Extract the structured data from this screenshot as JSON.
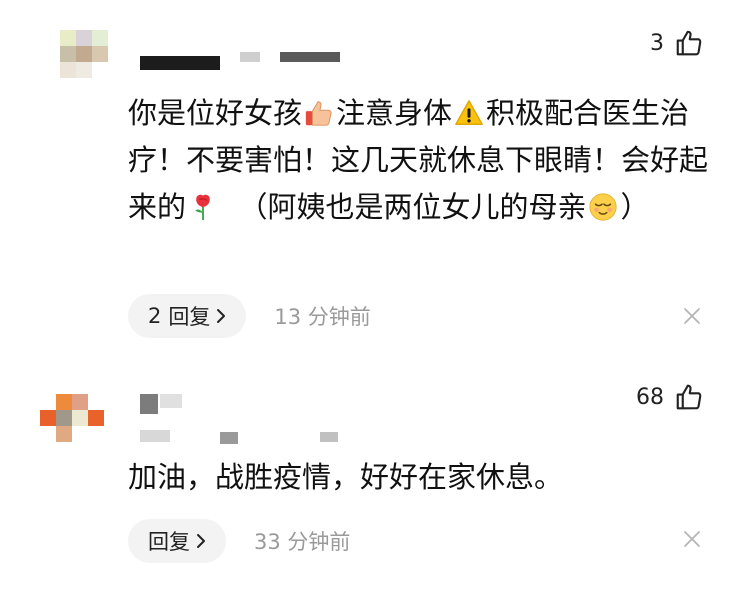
{
  "comments": [
    {
      "likes": "3",
      "text_parts": [
        "你是位好女孩",
        "注意身体",
        "积极配合医生治疗！不要害怕！这几天就休息下眼睛！会好起来的",
        "（阿姨也是两位女儿的母亲",
        "）"
      ],
      "emojis": [
        "thumbs-up-emoji",
        "warning-emoji",
        "rose-emoji",
        "relieved-face-emoji"
      ],
      "reply_label": "回复",
      "reply_count": "2",
      "time": "13 分钟前"
    },
    {
      "likes": "68",
      "text": "加油，战胜疫情，好好在家休息。",
      "reply_label": "回复",
      "time": "33 分钟前"
    }
  ],
  "colors": {
    "reply_bg": "#f3f3f3",
    "time_gray": "#9a9a9a",
    "text": "#111111"
  }
}
